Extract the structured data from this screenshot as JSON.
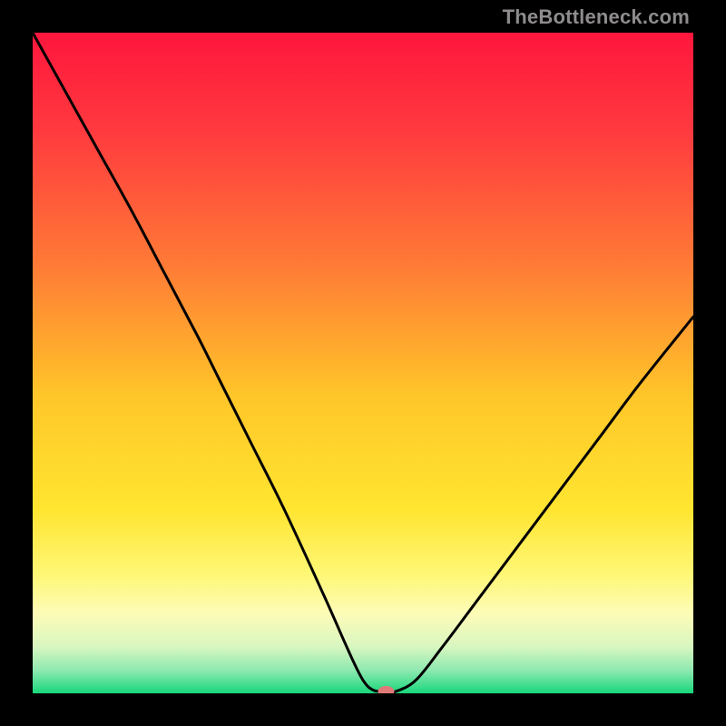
{
  "attribution": "TheBottleneck.com",
  "chart_data": {
    "type": "line",
    "title": "",
    "xlabel": "",
    "ylabel": "",
    "xlim": [
      0,
      100
    ],
    "ylim": [
      0,
      100
    ],
    "background": {
      "gradient_stops": [
        {
          "offset": 0.0,
          "color": "#ff163d"
        },
        {
          "offset": 0.15,
          "color": "#ff3a3f"
        },
        {
          "offset": 0.35,
          "color": "#ff7a36"
        },
        {
          "offset": 0.55,
          "color": "#ffc629"
        },
        {
          "offset": 0.72,
          "color": "#ffe530"
        },
        {
          "offset": 0.82,
          "color": "#fff776"
        },
        {
          "offset": 0.88,
          "color": "#fdfcb8"
        },
        {
          "offset": 0.93,
          "color": "#d7f6c0"
        },
        {
          "offset": 0.965,
          "color": "#8ee9b0"
        },
        {
          "offset": 1.0,
          "color": "#18d77b"
        }
      ]
    },
    "series": [
      {
        "name": "bottleneck-curve",
        "color": "#000000",
        "stroke_width": 3,
        "x": [
          0,
          5,
          10,
          15,
          20,
          25,
          28,
          33,
          38,
          44,
          48,
          50,
          51.5,
          53,
          54,
          55,
          58,
          62,
          68,
          74,
          80,
          86,
          92,
          100
        ],
        "y": [
          100,
          91,
          82,
          73,
          63.5,
          54,
          48,
          38,
          28,
          15,
          6,
          2,
          0.5,
          0.3,
          0.3,
          0.3,
          2,
          7,
          15,
          23,
          31,
          39,
          47,
          57
        ]
      }
    ],
    "marker": {
      "name": "optimal-point",
      "x": 53.5,
      "y": 0.3,
      "rx": 9,
      "ry": 6,
      "color": "#e07a78"
    }
  }
}
